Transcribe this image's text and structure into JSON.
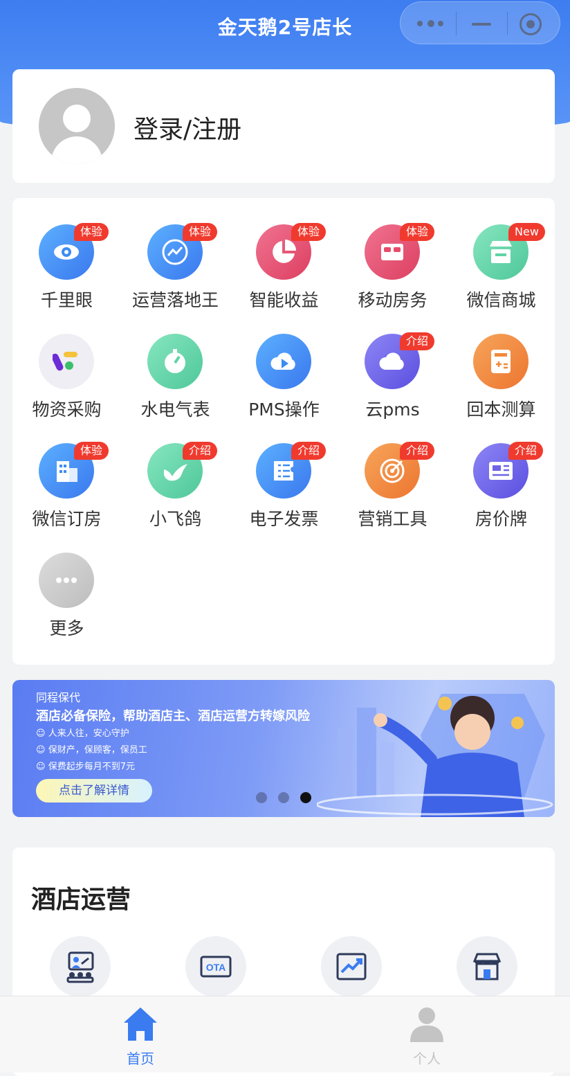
{
  "nav": {
    "title": "金天鹅2号店长"
  },
  "profile": {
    "login_label": "登录/注册"
  },
  "apps": [
    {
      "label": "千里眼",
      "badge": "体验",
      "icon": "eye-icon",
      "color": "#3d8cf2"
    },
    {
      "label": "运营落地王",
      "badge": "体验",
      "icon": "trend-chat-icon",
      "color": "#3d8cf2"
    },
    {
      "label": "智能收益",
      "badge": "体验",
      "icon": "pie-chart-icon",
      "color": "#e84c6b"
    },
    {
      "label": "移动房务",
      "badge": "体验",
      "icon": "bed-icon",
      "color": "#e84c6b"
    },
    {
      "label": "微信商城",
      "badge": "New",
      "icon": "storefront-icon",
      "color": "#5fd3a4"
    },
    {
      "label": "物资采购",
      "badge": "",
      "icon": "purchase-logo-icon",
      "color": "#eeeef4"
    },
    {
      "label": "水电气表",
      "badge": "",
      "icon": "stopwatch-icon",
      "color": "#5fd3a4"
    },
    {
      "label": "PMS操作",
      "badge": "",
      "icon": "cloud-play-icon",
      "color": "#3d8cf2"
    },
    {
      "label": "云pms",
      "badge": "介绍",
      "icon": "cloud-icon",
      "color": "#6e63e6"
    },
    {
      "label": "回本测算",
      "badge": "",
      "icon": "calculator-icon",
      "color": "#f08a3a"
    },
    {
      "label": "微信订房",
      "badge": "体验",
      "icon": "building-icon",
      "color": "#3d8cf2"
    },
    {
      "label": "小飞鸽",
      "badge": "介绍",
      "icon": "bird-icon",
      "color": "#5fd3a4"
    },
    {
      "label": "电子发票",
      "badge": "介绍",
      "icon": "invoice-icon",
      "color": "#3d8cf2"
    },
    {
      "label": "营销工具",
      "badge": "介绍",
      "icon": "target-icon",
      "color": "#f08a3a"
    },
    {
      "label": "房价牌",
      "badge": "介绍",
      "icon": "price-board-icon",
      "color": "#6e63e6"
    },
    {
      "label": "更多",
      "badge": "",
      "icon": "more-icon",
      "color": "#c8c8c8"
    }
  ],
  "banner": {
    "brand": "同程保代",
    "title": "酒店必备保险，帮助酒店主、酒店运营方转嫁风险",
    "lines": [
      "人来人往，安心守护",
      "保财产，保顾客，保员工",
      "保费起步每月不到7元"
    ],
    "button": "点击了解详情",
    "active_slide": 3,
    "slide_count": 3
  },
  "ops": {
    "title": "酒店运营",
    "icons": [
      "training-icon",
      "ota-icon",
      "growth-chart-icon",
      "store-icon"
    ],
    "ota_text": "OTA"
  },
  "tabbar": {
    "items": [
      {
        "label": "首页",
        "icon": "home-icon",
        "active": true
      },
      {
        "label": "个人",
        "icon": "person-icon",
        "active": false
      }
    ],
    "active_color": "#3a7cf0",
    "inactive_color": "#c4c4c4"
  }
}
